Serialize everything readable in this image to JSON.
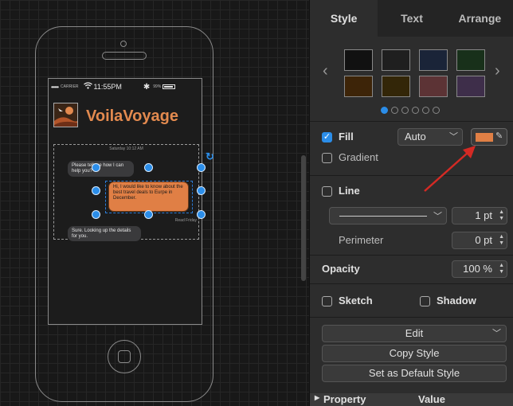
{
  "canvas": {
    "phone": {
      "status_bar": {
        "signal": "•••••",
        "carrier": "CARRIER",
        "time": "11:55PM",
        "battery_pct": "99%"
      },
      "app_title": "VoilaVoyage",
      "chat": {
        "date": "Saturday 10:12 AM",
        "messages": [
          {
            "text": "Please tell me how I can help you?",
            "side": "left"
          },
          {
            "text": "Hi, I would like to know about the best travel deals to Eurpe in December.",
            "side": "right"
          },
          {
            "text": "Sure. Looking up the details for you.",
            "side": "left"
          }
        ],
        "read_label": "Read Friday"
      }
    }
  },
  "panel": {
    "tabs": [
      {
        "label": "Style",
        "active": true
      },
      {
        "label": "Text",
        "active": false
      },
      {
        "label": "Arrange",
        "active": false
      }
    ],
    "swatches": [
      "#111111",
      "#1f1f1f",
      "#1a2438",
      "#18301a",
      "#3d2408",
      "#332608",
      "#5c3335",
      "#3e2e4a"
    ],
    "fill": {
      "label": "Fill",
      "checked": true,
      "mode": "Auto",
      "color": "#e07f45"
    },
    "gradient": {
      "label": "Gradient",
      "checked": false
    },
    "line": {
      "label": "Line",
      "checked": false,
      "width": "1 pt"
    },
    "perimeter": {
      "label": "Perimeter",
      "value": "0 pt"
    },
    "opacity": {
      "label": "Opacity",
      "value": "100 %"
    },
    "sketch": {
      "label": "Sketch",
      "checked": false
    },
    "shadow": {
      "label": "Shadow",
      "checked": false
    },
    "buttons": {
      "edit": "Edit",
      "copy_style": "Copy Style",
      "set_default": "Set as Default Style"
    },
    "property_table": {
      "col_property": "Property",
      "col_value": "Value"
    }
  },
  "colors": {
    "accent": "#2b8de8",
    "fill_orange": "#e07f45",
    "arrow_red": "#d42a24"
  }
}
